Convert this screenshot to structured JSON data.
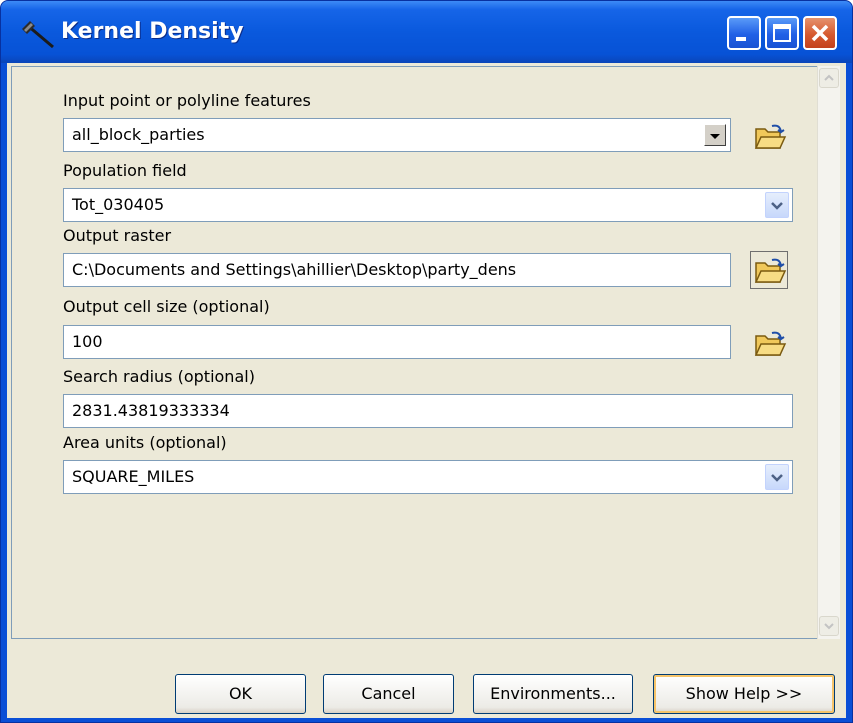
{
  "window": {
    "title": "Kernel Density",
    "icon": "hammer-icon",
    "controls": [
      "minimize-icon",
      "maximize-icon",
      "close-icon"
    ]
  },
  "form": {
    "input_features": {
      "label": "Input point or polyline features",
      "value": "all_block_parties"
    },
    "population_field": {
      "label": "Population field",
      "value": "Tot_030405"
    },
    "output_raster": {
      "label": "Output raster",
      "value": "C:\\Documents and Settings\\ahillier\\Desktop\\party_dens"
    },
    "cell_size": {
      "label": "Output cell size (optional)",
      "value": "100"
    },
    "search_radius": {
      "label": "Search radius (optional)",
      "value": "2831.43819333334"
    },
    "area_units": {
      "label": "Area units (optional)",
      "value": "SQUARE_MILES"
    }
  },
  "buttons": {
    "ok": "OK",
    "cancel": "Cancel",
    "environments": "Environments...",
    "show_help": "Show Help >>"
  },
  "colors": {
    "title_bar": "#0a59dd",
    "dialog_background": "#ece9d8",
    "close_button": "#d65a2f"
  }
}
